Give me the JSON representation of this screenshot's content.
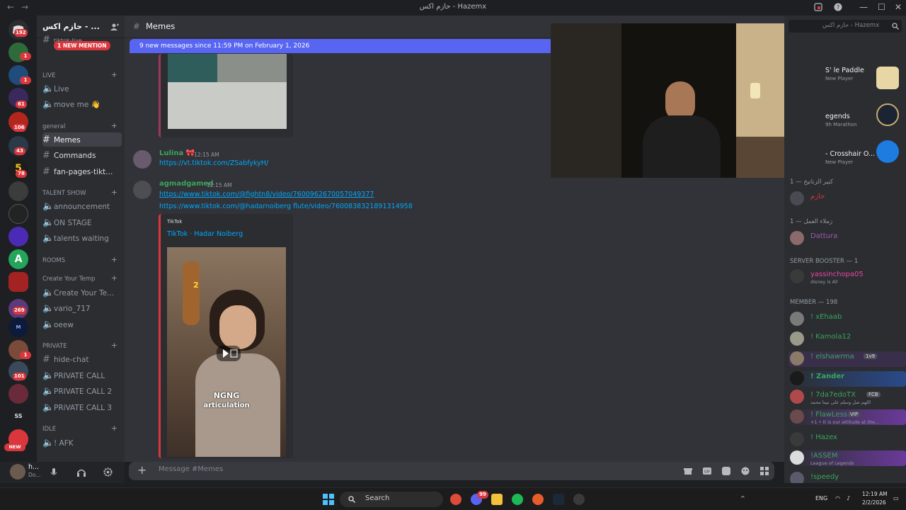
{
  "window": {
    "title": "حازم اكس - Hazemx",
    "back_glyph": "←",
    "forward_glyph": "→",
    "min_glyph": "—",
    "max_glyph": "☐",
    "close_glyph": "✕"
  },
  "rail": {
    "badges": [
      "192",
      "1",
      "1",
      "61",
      "106",
      "43",
      "78",
      "269",
      "1",
      "101"
    ],
    "new_label": "NEW",
    "ss_label": "SS"
  },
  "sidebar": {
    "guild_name": "حازم اكس - ...",
    "new_mention": "1 NEW MENTION",
    "hidden_channel": "tiktok-live",
    "categories": {
      "live": "LIVE",
      "general": "general",
      "talent": "TALENT SHOW",
      "rooms": "ROOMS",
      "create": "Create Your Temp",
      "private": "PRIVATE",
      "idle": "IDLE"
    },
    "channels": {
      "live": "Live",
      "move_me": "move me 👋",
      "memes": "Memes",
      "commands": "Commands",
      "fan_pages": "fan-pages-tikt...",
      "announcement": "announcement",
      "on_stage": "ON STAGE",
      "talents_waiting": "talents waiting",
      "create_your_te": "Create Your Te...",
      "vario": "vario_717",
      "oeew": "oeew",
      "hide_chat": "hide-chat",
      "private_call": "PRIVATE CALL",
      "private_call_2": "PRIVATE CALL 2",
      "private_call_3": "PRiVATE CALL 3",
      "afk": "! AFK"
    }
  },
  "user_panel": {
    "name": "h...",
    "status": "Do..."
  },
  "header": {
    "channel": "Memes"
  },
  "chat": {
    "new_messages_bar": "9 new messages since 11:59 PM on February 1, 2026",
    "messages": [
      {
        "author": "Lulina 🎀",
        "time": "12:15 AM",
        "link": "https://vt.tiktok.com/ZSabfykyH/"
      },
      {
        "author": "agmadgamed",
        "time": "12:15 AM",
        "link1": "https://www.tiktok.com/@fightn8/video/7600962670057049377",
        "link2": "https://www.tiktok.com/@hadarnoiberg flute/video/7600838321891314958",
        "embed_provider": "TikTok",
        "embed_title": "TikTok · Hadar Noiberg",
        "video_caption_1": "NGNG",
        "video_caption_2": "articulation",
        "video_number": "2"
      }
    ],
    "composer_placeholder": "Message #Memes"
  },
  "members": {
    "search_placeholder": "حازم اكس - Hazemx",
    "activities": [
      {
        "name": "S' le Paddle",
        "sub": "New Player"
      },
      {
        "name": "egends",
        "sub": "9h Marathon"
      },
      {
        "name": "- Crosshair O...",
        "sub": "New Player"
      }
    ],
    "role1": "كبير الزناتيخ — 1",
    "role1_member": "حازم",
    "role2": "زملاء العمل — 1",
    "role2_member": "Dattura",
    "role3": "SERVER BOOSTER — 1",
    "role3_member": "yassinchopa05",
    "role3_sub": "disney is All",
    "role4": "MEMBER — 198",
    "list": [
      {
        "name": "! xEhaab",
        "sub": "",
        "tag": ""
      },
      {
        "name": "! Kamola12",
        "sub": "",
        "tag": ""
      },
      {
        "name": "! elshawrma",
        "sub": "",
        "tag": "1v9"
      },
      {
        "name": "! Zander",
        "sub": "",
        "tag": ""
      },
      {
        "name": "! 7da7edoTX",
        "sub": "اللهم صل وسلم على نبينا محمد",
        "tag": "FCB"
      },
      {
        "name": "! FlawLess",
        "sub": "+1 • It is our attitude at the...",
        "tag": "VIP"
      },
      {
        "name": "! Hazex",
        "sub": "",
        "tag": ""
      },
      {
        "name": "!ASSEM",
        "sub": "League of Legends",
        "tag": ""
      },
      {
        "name": "!speedy",
        "sub": "",
        "tag": ""
      }
    ]
  },
  "taskbar": {
    "search": "Search",
    "lang": "ENG",
    "time": "12:19 AM",
    "date": "2/2/2026",
    "notif_badge": "99"
  },
  "colors": {
    "blurple": "#5865f2",
    "link": "#00a8fc",
    "green_name": "#3ba55c",
    "mention_red": "#da373c"
  }
}
